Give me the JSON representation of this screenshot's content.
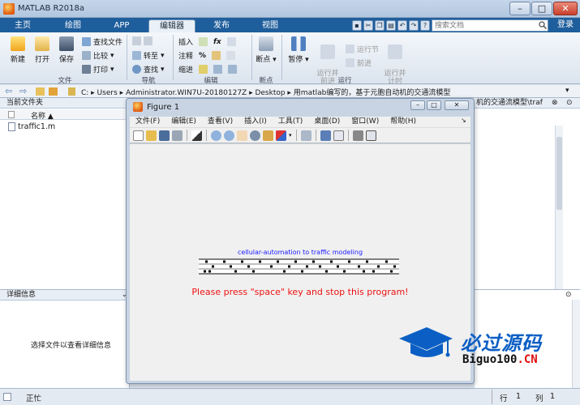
{
  "window": {
    "title": "MATLAB R2018a",
    "min": "–",
    "max": "□",
    "close": "✕"
  },
  "tabs": [
    {
      "label": "主页"
    },
    {
      "label": "绘图"
    },
    {
      "label": "APP"
    },
    {
      "label": "编辑器"
    },
    {
      "label": "发布"
    },
    {
      "label": "视图"
    }
  ],
  "search": {
    "placeholder": "搜索文档"
  },
  "login": "登录",
  "ribbon": {
    "file": {
      "new": "新建",
      "open": "打开",
      "save": "保存",
      "find_files": "查找文件",
      "compare": "比较",
      "print": "打印",
      "label": "文件"
    },
    "nav": {
      "goto": "转至",
      "find": "查找",
      "label": "导航"
    },
    "edit": {
      "insert": "插入",
      "comment": "注释",
      "indent": "缩进",
      "fx": "fx",
      "label": "编辑"
    },
    "breakpoints": {
      "breakpoints": "断点",
      "label": "断点"
    },
    "run": {
      "pause": "暂停",
      "run_advance": "运行并\n前进",
      "run_section": "运行节",
      "advance": "前进",
      "run_time": "运行并\n计时",
      "label": "运行"
    }
  },
  "address": {
    "path": "C: ▸ Users ▸ Administrator.WIN7U-20180127Z ▸ Desktop ▸ 用matlab编写的，基于元胞自动机的交通流模型"
  },
  "current_folder": {
    "title": "当前文件夹",
    "column": "名称 ▲",
    "files": [
      "traffic1.m"
    ]
  },
  "details": {
    "title": "详细信息",
    "message": "选择文件以查看详细信息"
  },
  "right_header": "机的交通流模型\\traf",
  "status": {
    "text": "正忙",
    "row_label": "行",
    "row": "1",
    "col_label": "列",
    "col": "1"
  },
  "figure": {
    "title": "Figure 1",
    "menu": [
      "文件(F)",
      "编辑(E)",
      "查看(V)",
      "插入(I)",
      "工具(T)",
      "桌面(D)",
      "窗口(W)",
      "帮助(H)"
    ],
    "plot_title": "cellular-automation to traffic modeling",
    "message": "Please press \"space\" key and stop this program!"
  },
  "watermark": {
    "cn": "必过源码",
    "en_a": "Biguo100",
    "en_b": ".CN"
  }
}
